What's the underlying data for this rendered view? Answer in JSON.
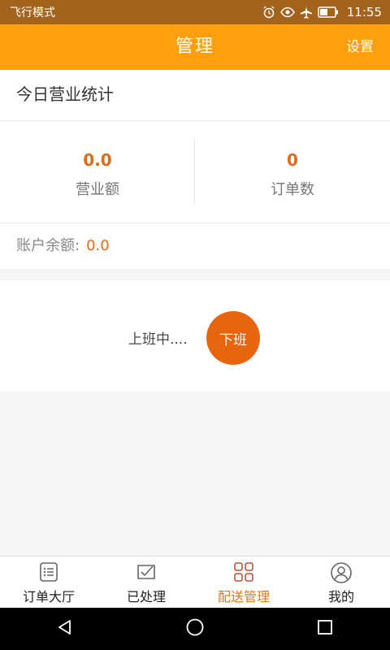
{
  "status_bar": {
    "carrier": "飞行模式",
    "time": "11:55"
  },
  "header": {
    "title": "管理",
    "settings": "设置"
  },
  "today": {
    "title": "今日营业统计",
    "revenue_value": "0.0",
    "revenue_label": "营业额",
    "orders_value": "0",
    "orders_label": "订单数"
  },
  "balance": {
    "label": "账户余额:",
    "value": "0.0"
  },
  "work": {
    "state": "上班中....",
    "button": "下班"
  },
  "tabs": [
    {
      "label": "订单大厅",
      "icon": "list-icon"
    },
    {
      "label": "已处理",
      "icon": "checked-envelope-icon"
    },
    {
      "label": "配送管理",
      "icon": "grid-icon",
      "active": true
    },
    {
      "label": "我的",
      "icon": "user-icon"
    }
  ],
  "colors": {
    "accent": "#ff9f0d",
    "status_bar": "#a4631c",
    "value_orange": "#e06a1a",
    "button_orange": "#e8650f"
  }
}
